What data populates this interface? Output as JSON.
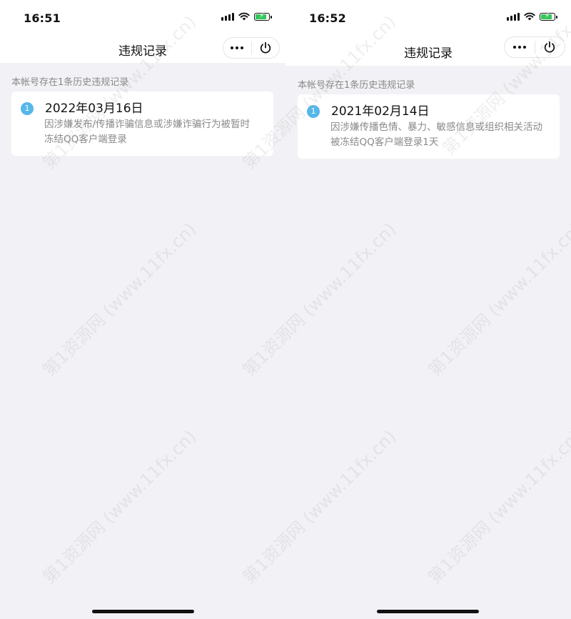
{
  "watermark": "第1资源网 (www.11fx.cn)",
  "screens": [
    {
      "time": "16:51",
      "nav_title": "违规记录",
      "note": "本帐号存在1条历史违规记录",
      "record": {
        "index": "1",
        "date": "2022年03月16日",
        "description": "因涉嫌发布/传播诈骗信息或涉嫌诈骗行为被暂时冻结QQ客户端登录"
      }
    },
    {
      "time": "16:52",
      "nav_title": "违规记录",
      "note": "本帐号存在1条历史违规记录",
      "record": {
        "index": "1",
        "date": "2021年02月14日",
        "description": "因涉嫌传播色情、暴力、敏感信息或组织相关活动被冻结QQ客户端登录1天"
      }
    }
  ],
  "icons": {
    "signal": "cellular-signal-icon",
    "wifi": "wifi-icon",
    "battery": "battery-charging-icon",
    "more": "more-dots-icon",
    "close": "power-icon"
  },
  "colors": {
    "badge": "#55b7ea",
    "background": "#f2f2f6",
    "battery": "#34c759"
  }
}
